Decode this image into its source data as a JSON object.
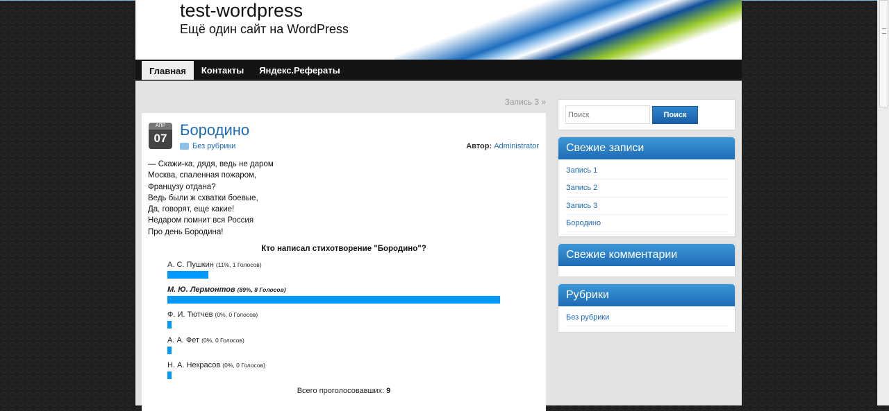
{
  "site": {
    "title": "test-wordpress",
    "description": "Ещё один сайт на WordPress"
  },
  "nav": [
    {
      "label": "Главная"
    },
    {
      "label": "Контакты"
    },
    {
      "label": "Яндекс.Рефераты"
    }
  ],
  "next_post": "Запись 3 »",
  "post": {
    "month": "АПР",
    "day": "07",
    "title": "Бородино",
    "category": "Без рубрики",
    "author_label": "Автор:",
    "author": "Administrator",
    "lines": [
      "— Скажи-ка, дядя, ведь не даром",
      "Москва, спаленная пожаром,",
      "Французу отдана?",
      "Ведь были ж схватки боевые,",
      "Да, говорят, еще какие!",
      "Недаром помнит вся Россия",
      "Про день Бородина!"
    ]
  },
  "poll": {
    "question": "Кто написал стихотворение \"Бородино\"?",
    "answers": [
      {
        "name": "А. С. Пушкин",
        "stats": "(11%, 1 Голосов)",
        "percent": 11
      },
      {
        "name": "М. Ю. Лермонтов",
        "stats": "(89%, 8 Голосов)",
        "percent": 89
      },
      {
        "name": "Ф. И. Тютчев",
        "stats": "(0%, 0 Голосов)",
        "percent": 0
      },
      {
        "name": "А. А. Фет",
        "stats": "(0%, 0 Голосов)",
        "percent": 0
      },
      {
        "name": "Н. А. Некрасов",
        "stats": "(0%, 0 Голосов)",
        "percent": 0
      }
    ],
    "total_label": "Всего проголосовавших:",
    "total": "9",
    "bar_color": "#0099ff"
  },
  "sidebar": {
    "search_placeholder": "Поиск",
    "search_button": "Поиск",
    "recent_title": "Свежие записи",
    "recent": [
      "Запись 1",
      "Запись 2",
      "Запись 3",
      "Бородино"
    ],
    "comments_title": "Свежие комментарии",
    "categories_title": "Рубрики",
    "categories": [
      "Без рубрики"
    ]
  }
}
